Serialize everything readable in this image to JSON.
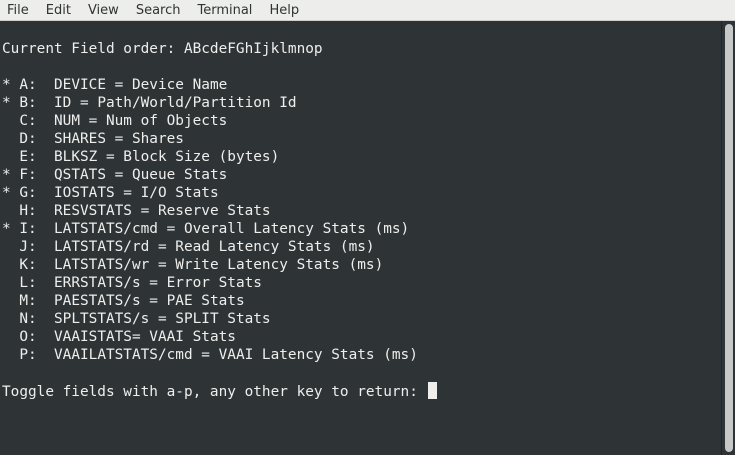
{
  "menubar": {
    "items": [
      "File",
      "Edit",
      "View",
      "Search",
      "Terminal",
      "Help"
    ]
  },
  "terminal": {
    "header": "Current Field order: ABcdeFGhIjklmnop",
    "fields": [
      {
        "marker": "*",
        "key": "A:",
        "text": "DEVICE = Device Name"
      },
      {
        "marker": "*",
        "key": "B:",
        "text": "ID = Path/World/Partition Id"
      },
      {
        "marker": " ",
        "key": "C:",
        "text": "NUM = Num of Objects"
      },
      {
        "marker": " ",
        "key": "D:",
        "text": "SHARES = Shares"
      },
      {
        "marker": " ",
        "key": "E:",
        "text": "BLKSZ = Block Size (bytes)"
      },
      {
        "marker": "*",
        "key": "F:",
        "text": "QSTATS = Queue Stats"
      },
      {
        "marker": "*",
        "key": "G:",
        "text": "IOSTATS = I/O Stats"
      },
      {
        "marker": " ",
        "key": "H:",
        "text": "RESVSTATS = Reserve Stats"
      },
      {
        "marker": "*",
        "key": "I:",
        "text": "LATSTATS/cmd = Overall Latency Stats (ms)"
      },
      {
        "marker": " ",
        "key": "J:",
        "text": "LATSTATS/rd = Read Latency Stats (ms)"
      },
      {
        "marker": " ",
        "key": "K:",
        "text": "LATSTATS/wr = Write Latency Stats (ms)"
      },
      {
        "marker": " ",
        "key": "L:",
        "text": "ERRSTATS/s = Error Stats"
      },
      {
        "marker": " ",
        "key": "M:",
        "text": "PAESTATS/s = PAE Stats"
      },
      {
        "marker": " ",
        "key": "N:",
        "text": "SPLTSTATS/s = SPLIT Stats"
      },
      {
        "marker": " ",
        "key": "O:",
        "text": "VAAISTATS= VAAI Stats"
      },
      {
        "marker": " ",
        "key": "P:",
        "text": "VAAILATSTATS/cmd = VAAI Latency Stats (ms)"
      }
    ],
    "prompt": "Toggle fields with a-p, any other key to return: "
  },
  "colors": {
    "terminal_bg": "#2e3436",
    "terminal_fg": "#eeeeec",
    "menubar_bg": "#ededeb"
  }
}
